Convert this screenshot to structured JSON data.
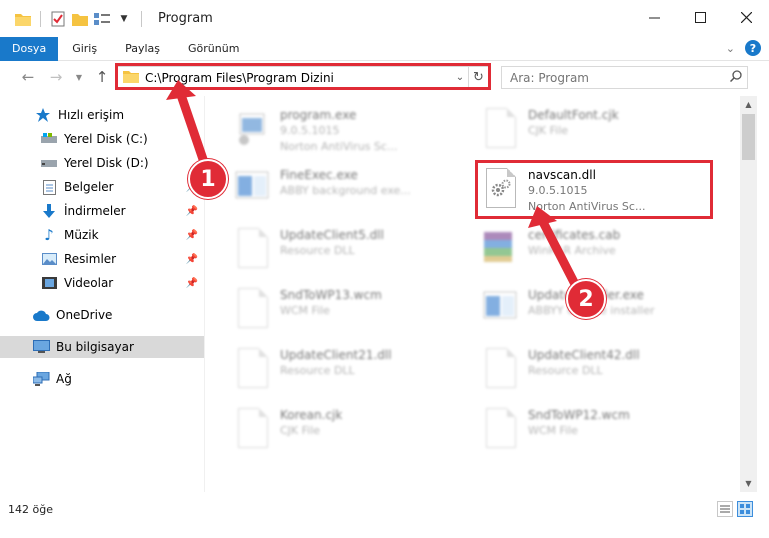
{
  "window": {
    "title": "Program",
    "minimize_icon": "minimize-icon",
    "maximize_icon": "maximize-icon",
    "close_icon": "close-icon"
  },
  "ribbon": {
    "tabs": [
      {
        "label": "Dosya",
        "active": true
      },
      {
        "label": "Giriş"
      },
      {
        "label": "Paylaş"
      },
      {
        "label": "Görünüm"
      }
    ],
    "help_label": "?"
  },
  "nav": {
    "address": "C:\\Program Files\\Program Dizini",
    "search_placeholder": "Ara: Program"
  },
  "sidebar": {
    "items": [
      {
        "label": "Hızlı erişim",
        "icon": "star-icon"
      },
      {
        "label": "Yerel Disk (C:)",
        "icon": "drive-icon"
      },
      {
        "label": "Yerel Disk (D:)",
        "icon": "drive-icon"
      },
      {
        "label": "Belgeler",
        "icon": "documents-icon"
      },
      {
        "label": "İndirmeler",
        "icon": "download-icon"
      },
      {
        "label": "Müzik",
        "icon": "music-icon"
      },
      {
        "label": "Resimler",
        "icon": "pictures-icon"
      },
      {
        "label": "Videolar",
        "icon": "videos-icon"
      },
      {
        "label": "OneDrive",
        "icon": "cloud-icon"
      },
      {
        "label": "Bu bilgisayar",
        "icon": "computer-icon"
      },
      {
        "label": "Ağ",
        "icon": "network-icon"
      }
    ]
  },
  "files": [
    {
      "name": "program.exe",
      "line2": "9.0.5.1015",
      "line3": "Norton AntiVirus Sc..."
    },
    {
      "name": "DefaultFont.cjk",
      "line2": "CJK File"
    },
    {
      "name": "FineExec.exe",
      "line2": "ABBY background exe..."
    },
    {
      "name": "navscan.dll",
      "line2": "9.0.5.1015",
      "line3": "Norton AntiVirus Sc..."
    },
    {
      "name": "UpdateClient5.dll",
      "line2": "Resource DLL"
    },
    {
      "name": "certificates.cab",
      "line2": "WinRAR Archive"
    },
    {
      "name": "SndToWP13.wcm",
      "line2": "WCM File"
    },
    {
      "name": "UpdateInstaller.exe",
      "line2": "ABBYY Update installer"
    },
    {
      "name": "UpdateClient21.dll",
      "line2": "Resource DLL"
    },
    {
      "name": "UpdateClient42.dll",
      "line2": "Resource DLL"
    },
    {
      "name": "Korean.cjk",
      "line2": "CJK File"
    },
    {
      "name": "SndToWP12.wcm",
      "line2": "WCM File"
    }
  ],
  "status": {
    "count": "142 öğe"
  },
  "annotations": {
    "badge1": "1",
    "badge2": "2",
    "color": "#e02b36"
  },
  "colors": {
    "accent": "#1979ca",
    "highlight": "#e02b36"
  }
}
